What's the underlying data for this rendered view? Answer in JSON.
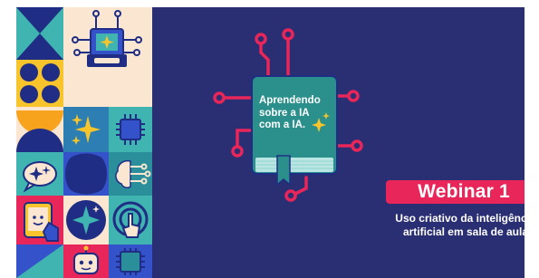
{
  "slide": {
    "book_lines": [
      "Aprendendo",
      "sobre a IA",
      "com a IA."
    ],
    "badge": "Webinar 1",
    "subtitle_lines": [
      "Uso criativo da inteligência",
      "artificial em sala de aula"
    ]
  },
  "colors": {
    "background": "#2a2e72",
    "accent_pink": "#e8265a",
    "book_teal": "#2b8f8c",
    "tile_cream": "#fbe6d2",
    "tile_teal": "#3fb4b0",
    "tile_blue": "#3452c9",
    "tile_navy": "#1f2e84",
    "spark_yellow": "#f7c52b"
  },
  "icons": [
    "hourglass-shape-icon",
    "circuit-ai-image-icon",
    "four-dots-icon",
    "semicircle-icon",
    "sparkle-icon",
    "chip-icon",
    "chat-sparkle-icon",
    "blob-shape-icon",
    "brain-circuit-icon",
    "tablet-hand-icon",
    "star-badge-icon",
    "touch-icon",
    "triangle-icon",
    "robot-icon",
    "chip-icon"
  ]
}
